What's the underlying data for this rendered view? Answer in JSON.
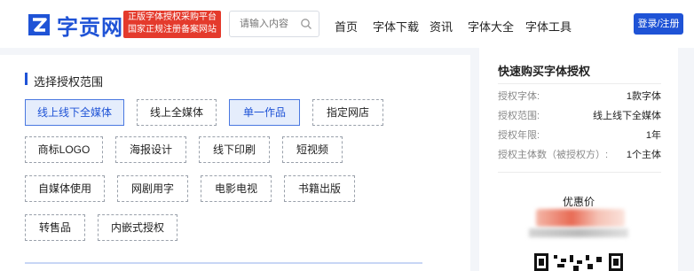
{
  "header": {
    "logo_text": "字贡网",
    "promo_line1": "正版字体授权采购平台",
    "promo_line2": "国家正规注册备案网站",
    "search_placeholder": "请输入内容",
    "nav": [
      "首页",
      "字体下载",
      "资讯",
      "字体大全",
      "字体工具"
    ],
    "login_label": "登录/注册",
    "brand_color": "#1f53d6",
    "promo_color": "#e43a2c"
  },
  "main": {
    "section_title": "选择授权范围",
    "options": [
      {
        "label": "线上线下全媒体",
        "selected": true
      },
      {
        "label": "线上全媒体",
        "selected": false
      },
      {
        "label": "单一作品",
        "selected": true
      },
      {
        "label": "指定网店",
        "selected": false
      },
      {
        "label": "商标LOGO",
        "selected": false
      },
      {
        "label": "海报设计",
        "selected": false
      },
      {
        "label": "线下印刷",
        "selected": false
      },
      {
        "label": "短视频",
        "selected": false
      },
      {
        "label": "自媒体使用",
        "selected": false
      },
      {
        "label": "网剧用字",
        "selected": false
      },
      {
        "label": "电影电视",
        "selected": false
      },
      {
        "label": "书籍出版",
        "selected": false
      },
      {
        "label": "转售品",
        "selected": false
      },
      {
        "label": "内嵌式授权",
        "selected": false
      }
    ]
  },
  "sidebar": {
    "title": "快速购买字体授权",
    "rows": [
      {
        "key": "授权字体:",
        "value": "1款字体"
      },
      {
        "key": "授权范围:",
        "value": "线上线下全媒体"
      },
      {
        "key": "授权年限:",
        "value": "1年"
      },
      {
        "key": "授权主体数（被授权方）:",
        "value": "1个主体"
      }
    ],
    "price_label": "优惠价"
  }
}
